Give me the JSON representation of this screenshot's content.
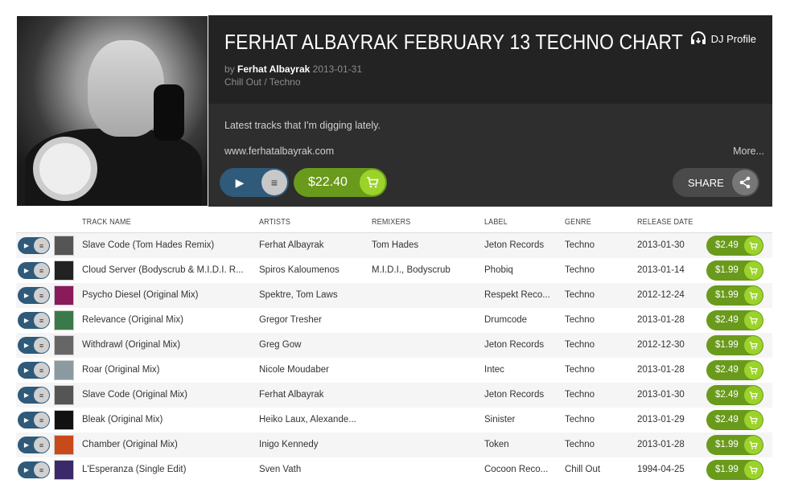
{
  "chart": {
    "title": "FERHAT ALBAYRAK FEBRUARY 13 TECHNO CHART",
    "by_prefix": "by",
    "author": "Ferhat Albayrak",
    "date": "2013-01-31",
    "genres": "Chill Out / Techno",
    "description": "Latest tracks that I'm digging lately.",
    "website": "www.ferhatalbayrak.com",
    "more_label": "More...",
    "dj_profile_label": "DJ Profile",
    "total_price": "$22.40",
    "share_label": "SHARE"
  },
  "colors": {
    "header_bg": "#232323",
    "play_blue": "#2f5a7a",
    "buy_green": "#6a9a1c",
    "cart_green": "#9bd32a"
  },
  "columns": {
    "track_name": "TRACK NAME",
    "artists": "ARTISTS",
    "remixers": "REMIXERS",
    "label": "LABEL",
    "genre": "GENRE",
    "release_date": "RELEASE DATE"
  },
  "tracks": [
    {
      "name": "Slave Code (Tom Hades Remix)",
      "artists": "Ferhat Albayrak",
      "remixers": "Tom Hades",
      "label": "Jeton Records",
      "genre": "Techno",
      "date": "2013-01-30",
      "price": "$2.49",
      "thumb": "#555"
    },
    {
      "name": "Cloud Server (Bodyscrub & M.I.D.I. R...",
      "artists": "Spiros Kaloumenos",
      "remixers": "M.I.D.I., Bodyscrub",
      "label": "Phobiq",
      "genre": "Techno",
      "date": "2013-01-14",
      "price": "$1.99",
      "thumb": "#222"
    },
    {
      "name": "Psycho Diesel (Original Mix)",
      "artists": "Spektre, Tom Laws",
      "remixers": "",
      "label": "Respekt Reco...",
      "genre": "Techno",
      "date": "2012-12-24",
      "price": "$1.99",
      "thumb": "#8a1a5a"
    },
    {
      "name": "Relevance (Original Mix)",
      "artists": "Gregor Tresher",
      "remixers": "",
      "label": "Drumcode",
      "genre": "Techno",
      "date": "2013-01-28",
      "price": "$2.49",
      "thumb": "#3a7a4a"
    },
    {
      "name": "Withdrawl (Original Mix)",
      "artists": "Greg Gow",
      "remixers": "",
      "label": "Jeton Records",
      "genre": "Techno",
      "date": "2012-12-30",
      "price": "$1.99",
      "thumb": "#666"
    },
    {
      "name": "Roar (Original Mix)",
      "artists": "Nicole Moudaber",
      "remixers": "",
      "label": "Intec",
      "genre": "Techno",
      "date": "2013-01-28",
      "price": "$2.49",
      "thumb": "#8a9aa0"
    },
    {
      "name": "Slave Code (Original Mix)",
      "artists": "Ferhat Albayrak",
      "remixers": "",
      "label": "Jeton Records",
      "genre": "Techno",
      "date": "2013-01-30",
      "price": "$2.49",
      "thumb": "#555"
    },
    {
      "name": "Bleak (Original Mix)",
      "artists": "Heiko Laux, Alexande...",
      "remixers": "",
      "label": "Sinister",
      "genre": "Techno",
      "date": "2013-01-29",
      "price": "$2.49",
      "thumb": "#111"
    },
    {
      "name": "Chamber (Original Mix)",
      "artists": "Inigo Kennedy",
      "remixers": "",
      "label": "Token",
      "genre": "Techno",
      "date": "2013-01-28",
      "price": "$1.99",
      "thumb": "#c84a1a"
    },
    {
      "name": "L'Esperanza (Single Edit)",
      "artists": "Sven Vath",
      "remixers": "",
      "label": "Cocoon Reco...",
      "genre": "Chill Out",
      "date": "1994-04-25",
      "price": "$1.99",
      "thumb": "#3a2a6a"
    }
  ]
}
